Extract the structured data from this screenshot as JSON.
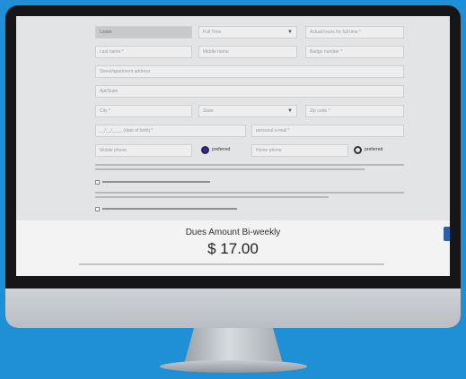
{
  "form": {
    "row1": {
      "first": "Loster",
      "employment": "Full Time",
      "hours": "Actual hours for full time *"
    },
    "row2": {
      "last": "Last name *",
      "middle": "Middle name",
      "badge": "Badge number *"
    },
    "street": "Street/apartment address",
    "address2": "Apt/Suite",
    "row4": {
      "city": "City *",
      "state": "State",
      "zip": "Zip code *"
    },
    "row5": {
      "dob": "__/__/____ (date of birth) *",
      "email": "personal e-mail *"
    },
    "row6": {
      "mobile": "Mobile phone",
      "mobile_pref": "preferred",
      "home": "Home phone",
      "home_pref": "preferred"
    }
  },
  "dues": {
    "title": "Dues Amount Bi-weekly",
    "amount": "$ 17.00"
  }
}
